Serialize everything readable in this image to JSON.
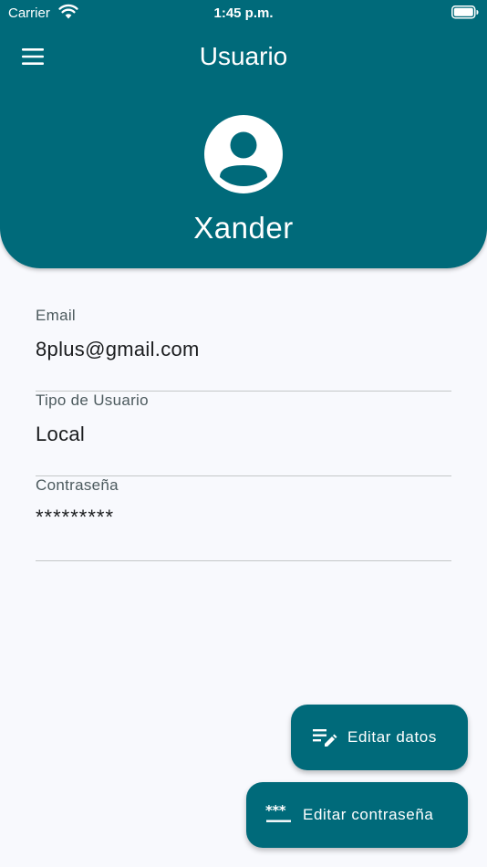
{
  "status_bar": {
    "carrier": "Carrier",
    "time": "1:45 p.m."
  },
  "app_bar": {
    "title": "Usuario",
    "menu_icon": "hamburger-menu-icon"
  },
  "profile": {
    "avatar_icon": "account-circle-icon",
    "name": "Xander"
  },
  "fields": [
    {
      "label": "Email",
      "value": "8plus@gmail.com"
    },
    {
      "label": "Tipo de Usuario",
      "value": "Local"
    },
    {
      "label": "Contraseña",
      "value": "*********"
    }
  ],
  "actions": {
    "edit_data": {
      "label": "Editar datos",
      "icon": "edit-note-icon"
    },
    "edit_password": {
      "label": "Editar contraseña",
      "icon": "password-icon"
    }
  },
  "colors": {
    "primary": "#006a7a",
    "background": "#f8f9fd",
    "on_primary": "#ffffff",
    "text_primary": "#1a1c1e",
    "text_secondary": "#4c5a5e",
    "divider": "#c4c7c8"
  }
}
